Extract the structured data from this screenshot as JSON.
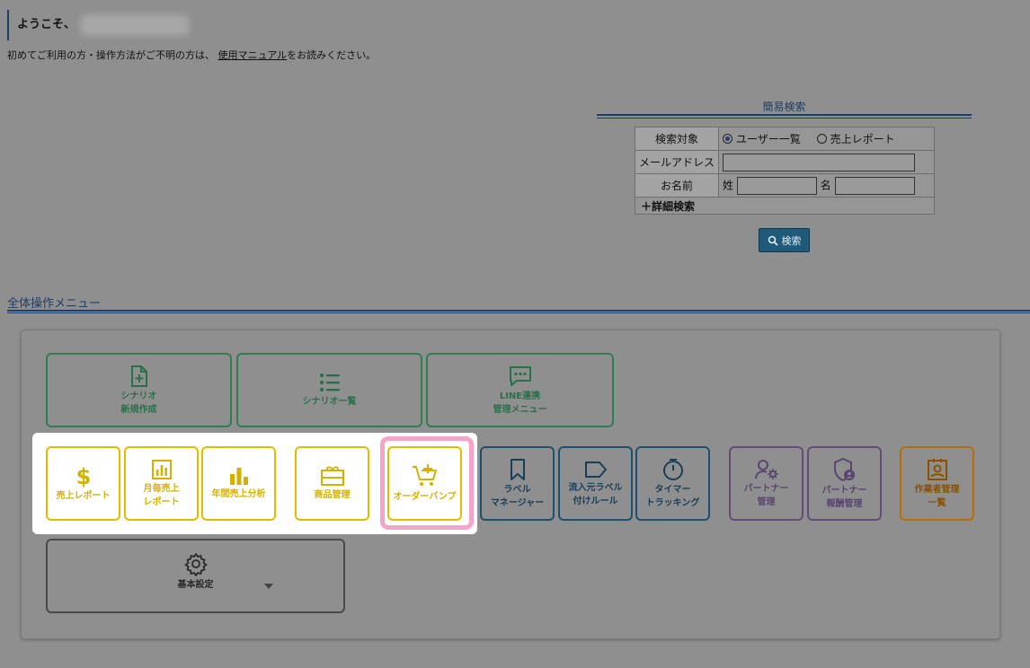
{
  "header": {
    "welcome": "ようこそ、",
    "intro_before": "初めてご利用の方・操作方法がご不明の方は、",
    "manual_link": "使用マニュアル",
    "intro_after": "をお読みください。"
  },
  "quick_search": {
    "title": "簡易検索",
    "target_label": "検索対象",
    "option_users": "ユーザー一覧",
    "option_sales": "売上レポート",
    "email_label": "メールアドレス",
    "name_label": "お名前",
    "last_name_label": "姓",
    "first_name_label": "名",
    "detail_search": "＋詳細検索",
    "search_button": "検索"
  },
  "menu": {
    "title": "全体操作メニュー",
    "scenario_new": [
      "シナリオ",
      "新規作成"
    ],
    "scenario_list": "シナリオ一覧",
    "line_menu": [
      "LINE連携",
      "管理メニュー"
    ],
    "sales_report": "売上レポート",
    "monthly_sales": [
      "月毎売上",
      "レポート"
    ],
    "annual_sales": "年間売上分析",
    "products": "商品管理",
    "order_bump": "オーダーバンプ",
    "label_manager": [
      "ラベル",
      "マネージャー"
    ],
    "source_label": [
      "流入元ラベル",
      "付けルール"
    ],
    "timer": [
      "タイマー",
      "トラッキング"
    ],
    "partner": [
      "パートナー",
      "管理"
    ],
    "partner_reward": [
      "パートナー",
      "報酬管理"
    ],
    "worker": [
      "作業者管理",
      "一覧"
    ],
    "basic_settings": "基本設定"
  },
  "colors": {
    "green": "#2f7d50",
    "yellow": "#e3bc00",
    "blue": "#1d5070",
    "purple": "#654c7a",
    "orange": "#b86e00",
    "highlight": "#f5a3c6"
  }
}
